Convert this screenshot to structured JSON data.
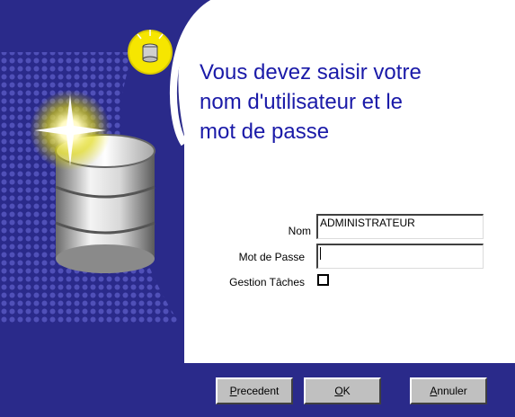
{
  "dialog": {
    "title_line1": "Vous devez saisir votre",
    "title_line2": "nom d'utilisateur et le",
    "title_line3": "mot de passe"
  },
  "form": {
    "user_label": "Nom",
    "user_value": "ADMINISTRATEUR",
    "password_label": "Mot de Passe",
    "password_value": "",
    "task_label": "Gestion Tâches",
    "task_checked": false
  },
  "buttons": {
    "prev_first": "P",
    "prev_rest": "recedent",
    "ok_first": "O",
    "ok_rest": "K",
    "cancel_first": "A",
    "cancel_rest": "nnuler"
  },
  "colors": {
    "background": "#2a2a8a",
    "panel": "#ffffff",
    "title": "#1a1aa8",
    "button": "#c0c0c0"
  },
  "icons": [
    "database-hint-icon",
    "database-illustration"
  ]
}
